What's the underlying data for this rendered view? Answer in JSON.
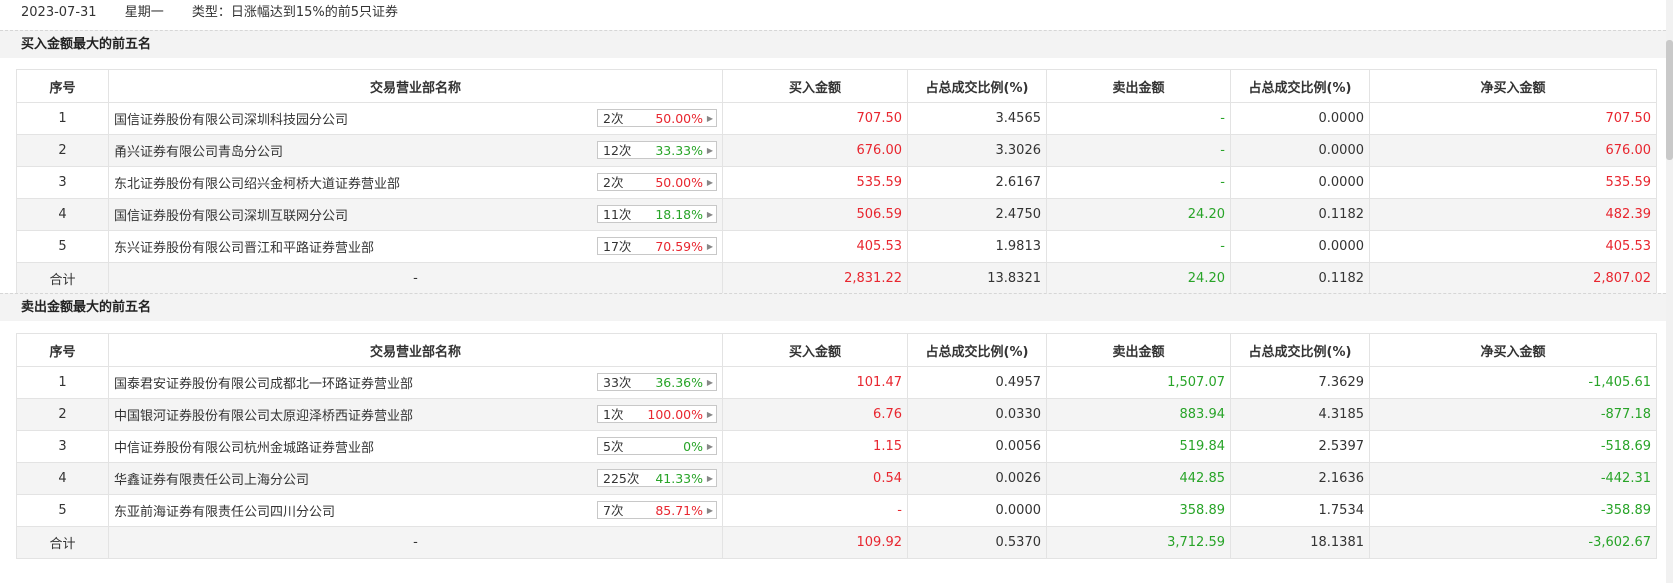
{
  "header": {
    "date": "2023-07-31",
    "weekday": "星期一",
    "type": "类型：日涨幅达到15%的前5只证券"
  },
  "columns": [
    "序号",
    "交易营业部名称",
    "买入金额",
    "占总成交比例(%)",
    "卖出金额",
    "占总成交比例(%)",
    "净买入金额"
  ],
  "colors": {
    "up": "#e8262f",
    "down": "#28a428"
  },
  "buy_section": {
    "title": "买入金额最大的前五名",
    "rows": [
      {
        "no": "1",
        "name": "国信证券股份有限公司深圳科技园分公司",
        "times": "2次",
        "pct": "50.00%",
        "pct_color": "red",
        "buy": "707.50",
        "buy_ratio": "3.4565",
        "sell": "-",
        "sell_ratio": "0.0000",
        "net": "707.50",
        "net_color": "red"
      },
      {
        "no": "2",
        "name": "甬兴证券有限公司青岛分公司",
        "times": "12次",
        "pct": "33.33%",
        "pct_color": "green",
        "buy": "676.00",
        "buy_ratio": "3.3026",
        "sell": "-",
        "sell_ratio": "0.0000",
        "net": "676.00",
        "net_color": "red"
      },
      {
        "no": "3",
        "name": "东北证券股份有限公司绍兴金柯桥大道证券营业部",
        "times": "2次",
        "pct": "50.00%",
        "pct_color": "red",
        "buy": "535.59",
        "buy_ratio": "2.6167",
        "sell": "-",
        "sell_ratio": "0.0000",
        "net": "535.59",
        "net_color": "red"
      },
      {
        "no": "4",
        "name": "国信证券股份有限公司深圳互联网分公司",
        "times": "11次",
        "pct": "18.18%",
        "pct_color": "green",
        "buy": "506.59",
        "buy_ratio": "2.4750",
        "sell": "24.20",
        "sell_ratio": "0.1182",
        "net": "482.39",
        "net_color": "red"
      },
      {
        "no": "5",
        "name": "东兴证券股份有限公司晋江和平路证券营业部",
        "times": "17次",
        "pct": "70.59%",
        "pct_color": "red",
        "buy": "405.53",
        "buy_ratio": "1.9813",
        "sell": "-",
        "sell_ratio": "0.0000",
        "net": "405.53",
        "net_color": "red"
      }
    ],
    "total": {
      "label": "合计",
      "name": "-",
      "buy": "2,831.22",
      "buy_ratio": "13.8321",
      "sell": "24.20",
      "sell_ratio": "0.1182",
      "net": "2,807.02",
      "net_color": "red"
    }
  },
  "sell_section": {
    "title": "卖出金额最大的前五名",
    "rows": [
      {
        "no": "1",
        "name": "国泰君安证券股份有限公司成都北一环路证券营业部",
        "times": "33次",
        "pct": "36.36%",
        "pct_color": "green",
        "buy": "101.47",
        "buy_ratio": "0.4957",
        "sell": "1,507.07",
        "sell_ratio": "7.3629",
        "net": "-1,405.61",
        "net_color": "green"
      },
      {
        "no": "2",
        "name": "中国银河证券股份有限公司太原迎泽桥西证券营业部",
        "times": "1次",
        "pct": "100.00%",
        "pct_color": "red",
        "buy": "6.76",
        "buy_ratio": "0.0330",
        "sell": "883.94",
        "sell_ratio": "4.3185",
        "net": "-877.18",
        "net_color": "green"
      },
      {
        "no": "3",
        "name": "中信证券股份有限公司杭州金城路证券营业部",
        "times": "5次",
        "pct": "0%",
        "pct_color": "green",
        "buy": "1.15",
        "buy_ratio": "0.0056",
        "sell": "519.84",
        "sell_ratio": "2.5397",
        "net": "-518.69",
        "net_color": "green"
      },
      {
        "no": "4",
        "name": "华鑫证券有限责任公司上海分公司",
        "times": "225次",
        "pct": "41.33%",
        "pct_color": "green",
        "buy": "0.54",
        "buy_ratio": "0.0026",
        "sell": "442.85",
        "sell_ratio": "2.1636",
        "net": "-442.31",
        "net_color": "green"
      },
      {
        "no": "5",
        "name": "东亚前海证券有限责任公司四川分公司",
        "times": "7次",
        "pct": "85.71%",
        "pct_color": "red",
        "buy": "-",
        "buy_ratio": "0.0000",
        "sell": "358.89",
        "sell_ratio": "1.7534",
        "net": "-358.89",
        "net_color": "green"
      }
    ],
    "total": {
      "label": "合计",
      "name": "-",
      "buy": "109.92",
      "buy_ratio": "0.5370",
      "sell": "3,712.59",
      "sell_ratio": "18.1381",
      "net": "-3,602.67",
      "net_color": "green"
    }
  }
}
